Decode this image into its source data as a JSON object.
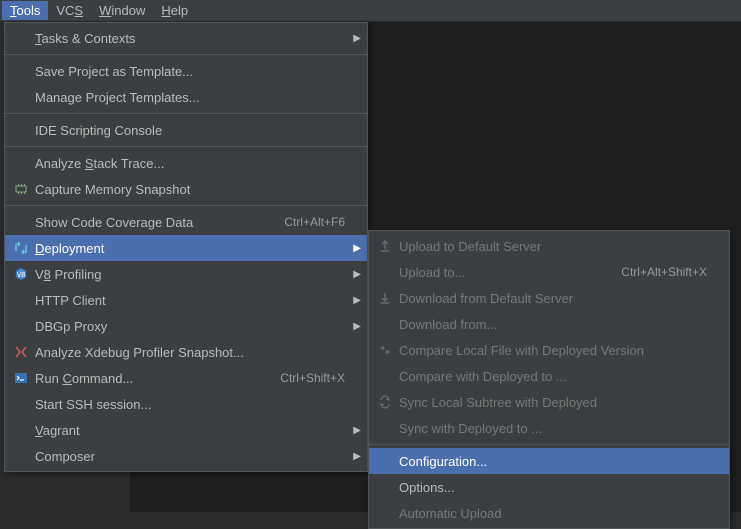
{
  "menubar": {
    "tools": "Tools",
    "vcs": "VCS",
    "window": "Window",
    "help": "Help"
  },
  "toolsMenu": {
    "tasks": "Tasks & Contexts",
    "saveTemplate": "Save Project as Template...",
    "manageTemplates": "Manage Project Templates...",
    "ideScripting": "IDE Scripting Console",
    "analyzeStack": "Analyze Stack Trace...",
    "captureMemory": "Capture Memory Snapshot",
    "showCoverage": "Show Code Coverage Data",
    "showCoverageShortcut": "Ctrl+Alt+F6",
    "deployment": "Deployment",
    "v8": "V8 Profiling",
    "httpClient": "HTTP Client",
    "dbgp": "DBGp Proxy",
    "analyzeXdebug": "Analyze Xdebug Profiler Snapshot...",
    "runCommand": "Run Command...",
    "runCommandShortcut": "Ctrl+Shift+X",
    "startSsh": "Start SSH session...",
    "vagrant": "Vagrant",
    "composer": "Composer"
  },
  "deploymentMenu": {
    "uploadDefault": "Upload to Default Server",
    "uploadTo": "Upload to...",
    "uploadToShortcut": "Ctrl+Alt+Shift+X",
    "downloadDefault": "Download from Default Server",
    "downloadFrom": "Download from...",
    "compareLocal": "Compare Local File with Deployed Version",
    "compareWith": "Compare with Deployed to ...",
    "syncLocal": "Sync Local Subtree with Deployed",
    "syncWith": "Sync with Deployed to ...",
    "configuration": "Configuration...",
    "options": "Options...",
    "automaticUpload": "Automatic Upload"
  }
}
